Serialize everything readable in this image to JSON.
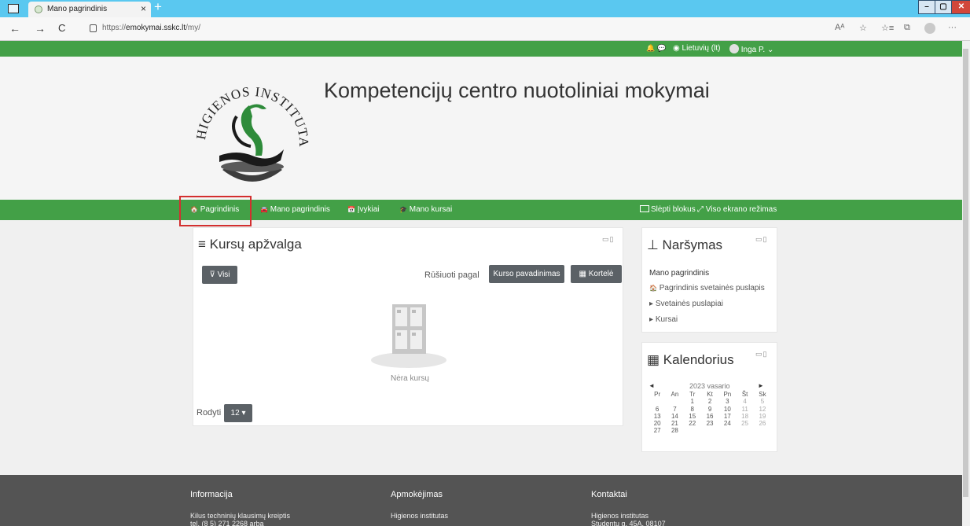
{
  "browser": {
    "tab_title": "Mano pagrindinis",
    "tab_close": "×",
    "new_tab": "+",
    "url_prefix": "https://",
    "url_host": "emokymai.sskc.lt",
    "url_path": "/my/",
    "window_buttons": [
      "–",
      "▢",
      "✕"
    ],
    "nav_back": "←",
    "nav_forward": "→",
    "nav_reload": "C",
    "toolbar_icons": [
      "Aᴬ",
      "☆",
      "☆≡",
      "⧉",
      "···"
    ]
  },
  "topbar": {
    "bell": "🔔",
    "chat": "💬",
    "language": "Lietuvių (lt)",
    "user": "Inga P.",
    "user_caret": "⌄"
  },
  "header": {
    "site_title": "Kompetencijų centro nuotoliniai mokymai",
    "logo_text": "HIGIENOS INSTITUTAS"
  },
  "mainnav": {
    "items": [
      {
        "icon": "🏠",
        "label": "Pagrindinis"
      },
      {
        "icon": "🚘",
        "label": "Mano pagrindinis"
      },
      {
        "icon": "📅",
        "label": "Įvykiai"
      },
      {
        "icon": "🎓",
        "label": "Mano kursai"
      }
    ],
    "hide_blocks": "Slėpti blokus",
    "fullscreen": "Viso ekrano režimas"
  },
  "course_overview": {
    "title": "Kursų apžvalga",
    "filter_button": "Visi",
    "sort_label": "Rūšiuoti pagal",
    "sort_button": "Kurso pavadinimas",
    "view_button": "Kortelė",
    "empty_text": "Nėra kursų",
    "show_label": "Rodyti",
    "show_value": "12"
  },
  "navigation_block": {
    "title": "Naršymas",
    "heading": "Mano pagrindinis",
    "links": [
      {
        "icon": "🏠",
        "label": "Pagrindinis svetainės puslapis"
      },
      {
        "icon": "▸",
        "label": "Svetainės puslapiai"
      },
      {
        "icon": "▸",
        "label": "Kursai"
      }
    ]
  },
  "calendar_block": {
    "title": "Kalendorius",
    "prev": "◄",
    "next": "►",
    "month": "2023 vasario",
    "weekdays": [
      "Pr",
      "An",
      "Tr",
      "Kt",
      "Pn",
      "Št",
      "Sk"
    ],
    "days": [
      "",
      "",
      "1",
      "2",
      "3",
      "4",
      "5",
      "6",
      "7",
      "8",
      "9",
      "10",
      "11",
      "12",
      "13",
      "14",
      "15",
      "16",
      "17",
      "18",
      "19",
      "20",
      "21",
      "22",
      "23",
      "24",
      "25",
      "26",
      "27",
      "28",
      "",
      "",
      "",
      "",
      ""
    ]
  },
  "footer": {
    "columns": [
      {
        "title": "Informacija",
        "lines": [
          "Kilus techninių klausimų kreiptis",
          "tel. (8 5) 271 2268 arba"
        ]
      },
      {
        "title": "Apmokėjimas",
        "lines": [
          "Higienos institutas"
        ]
      },
      {
        "title": "Kontaktai",
        "lines": [
          "Higienos institutas",
          "Studentų g. 45A, 08107"
        ]
      }
    ]
  },
  "colors": {
    "brand_green": "#43a047",
    "button_gray": "#5b6166",
    "footer_gray": "#545454",
    "highlight_red": "#d32f2f"
  }
}
